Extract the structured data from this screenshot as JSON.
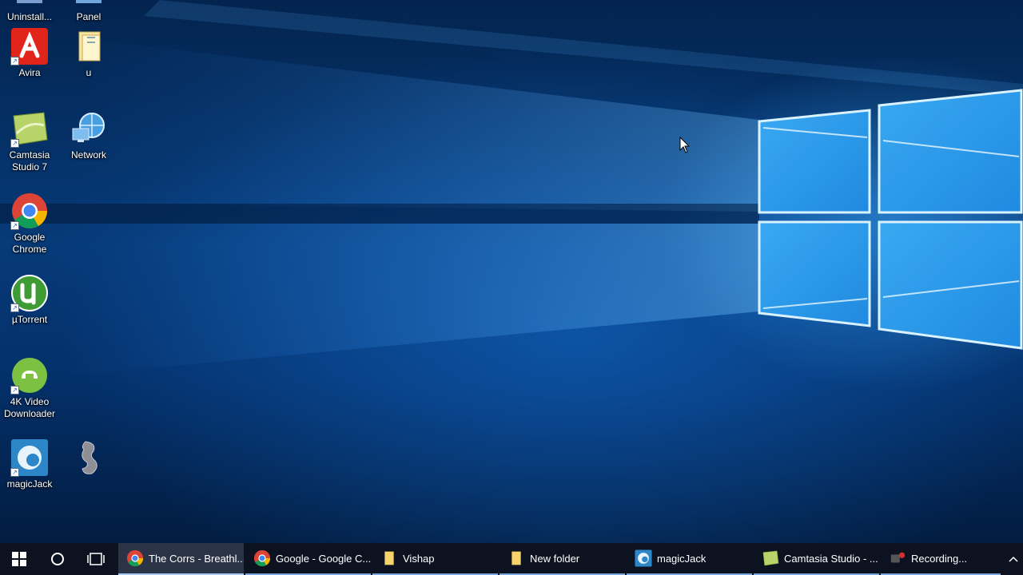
{
  "desktop": {
    "shortcuts": [
      {
        "label": "Uninstall...",
        "icon": "uninstall-icon"
      },
      {
        "label": "Panel",
        "icon": "control-panel-icon"
      },
      {
        "label": "Avira",
        "icon": "avira-icon"
      },
      {
        "label": "u",
        "icon": "folder-icon"
      },
      {
        "label": "Camtasia Studio 7",
        "icon": "camtasia-icon"
      },
      {
        "label": "Network",
        "icon": "network-icon"
      },
      {
        "label": "Google Chrome",
        "icon": "chrome-icon"
      },
      {
        "label": "µTorrent",
        "icon": "utorrent-icon"
      },
      {
        "label": "4K Video Downloader",
        "icon": "4k-video-downloader-icon"
      },
      {
        "label": "magicJack",
        "icon": "magicjack-icon"
      },
      {
        "label": "",
        "icon": "dragon-icon"
      }
    ]
  },
  "taskbar": {
    "start_icon": "windows-start-icon",
    "search_icon": "cortana-circle-icon",
    "task_view_icon": "task-view-icon",
    "tasks": [
      {
        "label": "The Corrs - Breathl...",
        "icon": "chrome-icon",
        "active": true
      },
      {
        "label": "Google - Google C...",
        "icon": "chrome-icon",
        "active": false
      },
      {
        "label": "Vishap",
        "icon": "folder-icon",
        "active": false
      },
      {
        "label": "New folder",
        "icon": "folder-icon",
        "active": false
      },
      {
        "label": "magicJack",
        "icon": "magicjack-icon",
        "active": false
      },
      {
        "label": "Camtasia Studio - ...",
        "icon": "camtasia-icon",
        "active": false
      },
      {
        "label": "Recording...",
        "icon": "recorder-icon",
        "active": false
      }
    ],
    "tray_icon": "chevron-up-icon"
  },
  "colors": {
    "accent": "#1e88e5",
    "taskbar_bg": "#0c1220",
    "task_indicator": "#7aa6e0"
  }
}
